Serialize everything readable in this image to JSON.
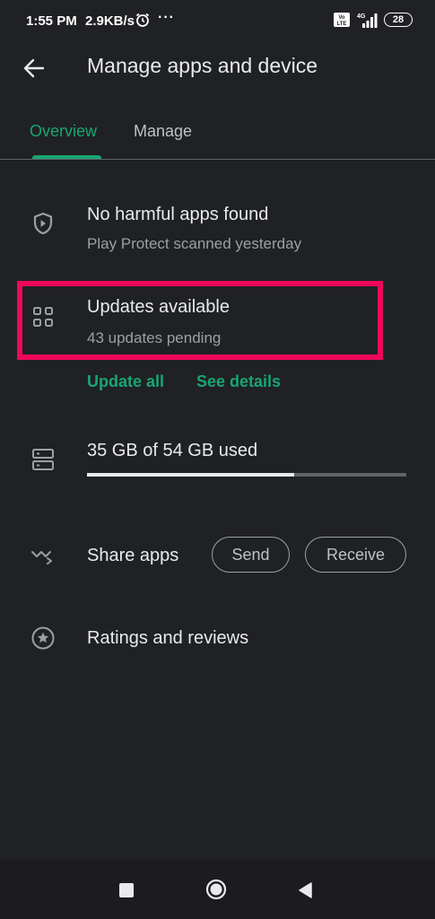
{
  "status_bar": {
    "time": "1:55 PM",
    "speed": "2.9KB/s",
    "dots": "···",
    "network_badge": "Vo LTE",
    "network_type": "4G",
    "battery": "28"
  },
  "header": {
    "title": "Manage apps and device",
    "back_icon": "arrow-left-icon"
  },
  "tabs": [
    {
      "label": "Overview",
      "selected": true
    },
    {
      "label": "Manage",
      "selected": false
    }
  ],
  "protect": {
    "title": "No harmful apps found",
    "subtitle": "Play Protect scanned yesterday"
  },
  "updates": {
    "title": "Updates available",
    "subtitle": "43 updates pending",
    "update_all": "Update all",
    "see_details": "See details",
    "highlight_color": "#f0085a"
  },
  "storage": {
    "label": "35 GB of 54 GB used",
    "used_fraction": 0.648
  },
  "share": {
    "label": "Share apps",
    "send": "Send",
    "receive": "Receive"
  },
  "ratings": {
    "label": "Ratings and reviews"
  },
  "colors": {
    "accent": "#17a673",
    "background": "#202124"
  }
}
